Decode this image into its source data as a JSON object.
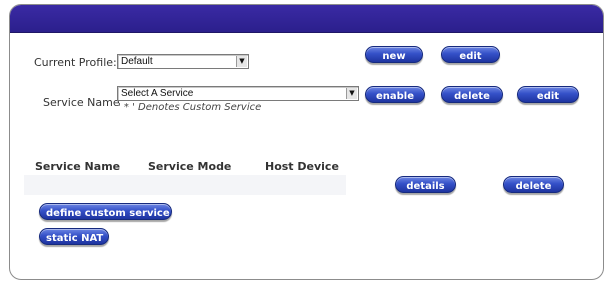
{
  "profile": {
    "label": "Current Profile:",
    "value": "Default"
  },
  "service": {
    "label": "Service Name",
    "value": "Select A Service",
    "note": "' * ' Denotes Custom Service"
  },
  "buttons": {
    "profile_new": "new",
    "profile_edit": "edit",
    "service_enable": "enable",
    "service_delete": "delete",
    "service_edit": "edit",
    "details": "details",
    "table_delete": "delete",
    "define_custom_service": "define custom service",
    "static_nat": "static NAT"
  },
  "table": {
    "columns": [
      "Service Name",
      "Service Mode",
      "Host Device"
    ]
  },
  "colors": {
    "header": "#2b1f8c",
    "button": "#3450c8"
  }
}
